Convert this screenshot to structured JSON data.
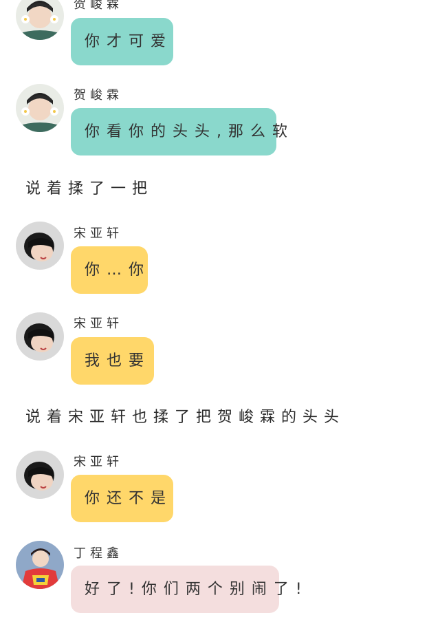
{
  "colors": {
    "teal_bubble": "#8ad8cc",
    "yellow_bubble": "#ffd76a",
    "pink_bubble": "#f4dede"
  },
  "messages": [
    {
      "sender": "贺峻霖",
      "text": "你才可爱",
      "color": "teal",
      "avatar": "boy-flowers-avatar"
    },
    {
      "sender": "贺峻霖",
      "text": "你看你的头头,那么软",
      "color": "teal",
      "avatar": "boy-flowers-avatar"
    },
    {
      "narration": "说着揉了一把"
    },
    {
      "sender": "宋亚轩",
      "text": "你…你",
      "color": "yellow",
      "avatar": "boy-lying-avatar"
    },
    {
      "sender": "宋亚轩",
      "text": "我也要",
      "color": "yellow",
      "avatar": "boy-lying-avatar"
    },
    {
      "narration": "说着宋亚轩也揉了把贺峻霖的头头"
    },
    {
      "sender": "宋亚轩",
      "text": "你还不是",
      "color": "yellow",
      "avatar": "boy-lying-avatar"
    },
    {
      "sender": "丁程鑫",
      "text": "好了!你们两个别闹了!",
      "color": "pink",
      "avatar": "boy-jersey-avatar"
    }
  ]
}
